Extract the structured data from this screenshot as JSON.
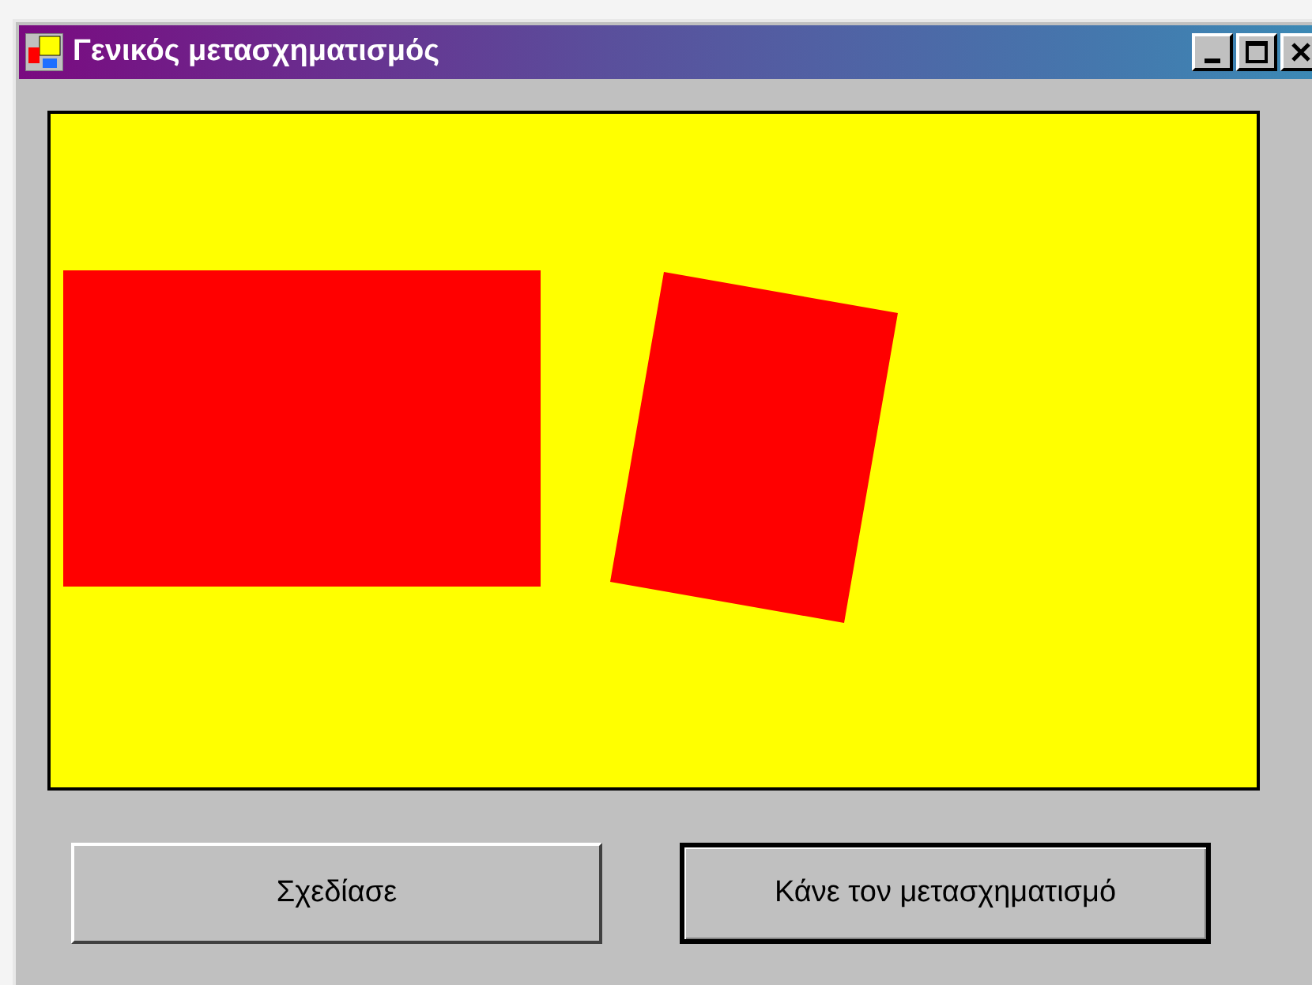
{
  "window": {
    "title": "Γενικός μετασχηματισμός",
    "controls": [
      {
        "kind": "minimize"
      },
      {
        "kind": "maximize"
      },
      {
        "kind": "close"
      }
    ]
  },
  "buttons": [
    {
      "label": "Σχεδίασε",
      "default": false
    },
    {
      "label": "Κάνε τον μετασχηματισμό",
      "default": true
    }
  ]
}
